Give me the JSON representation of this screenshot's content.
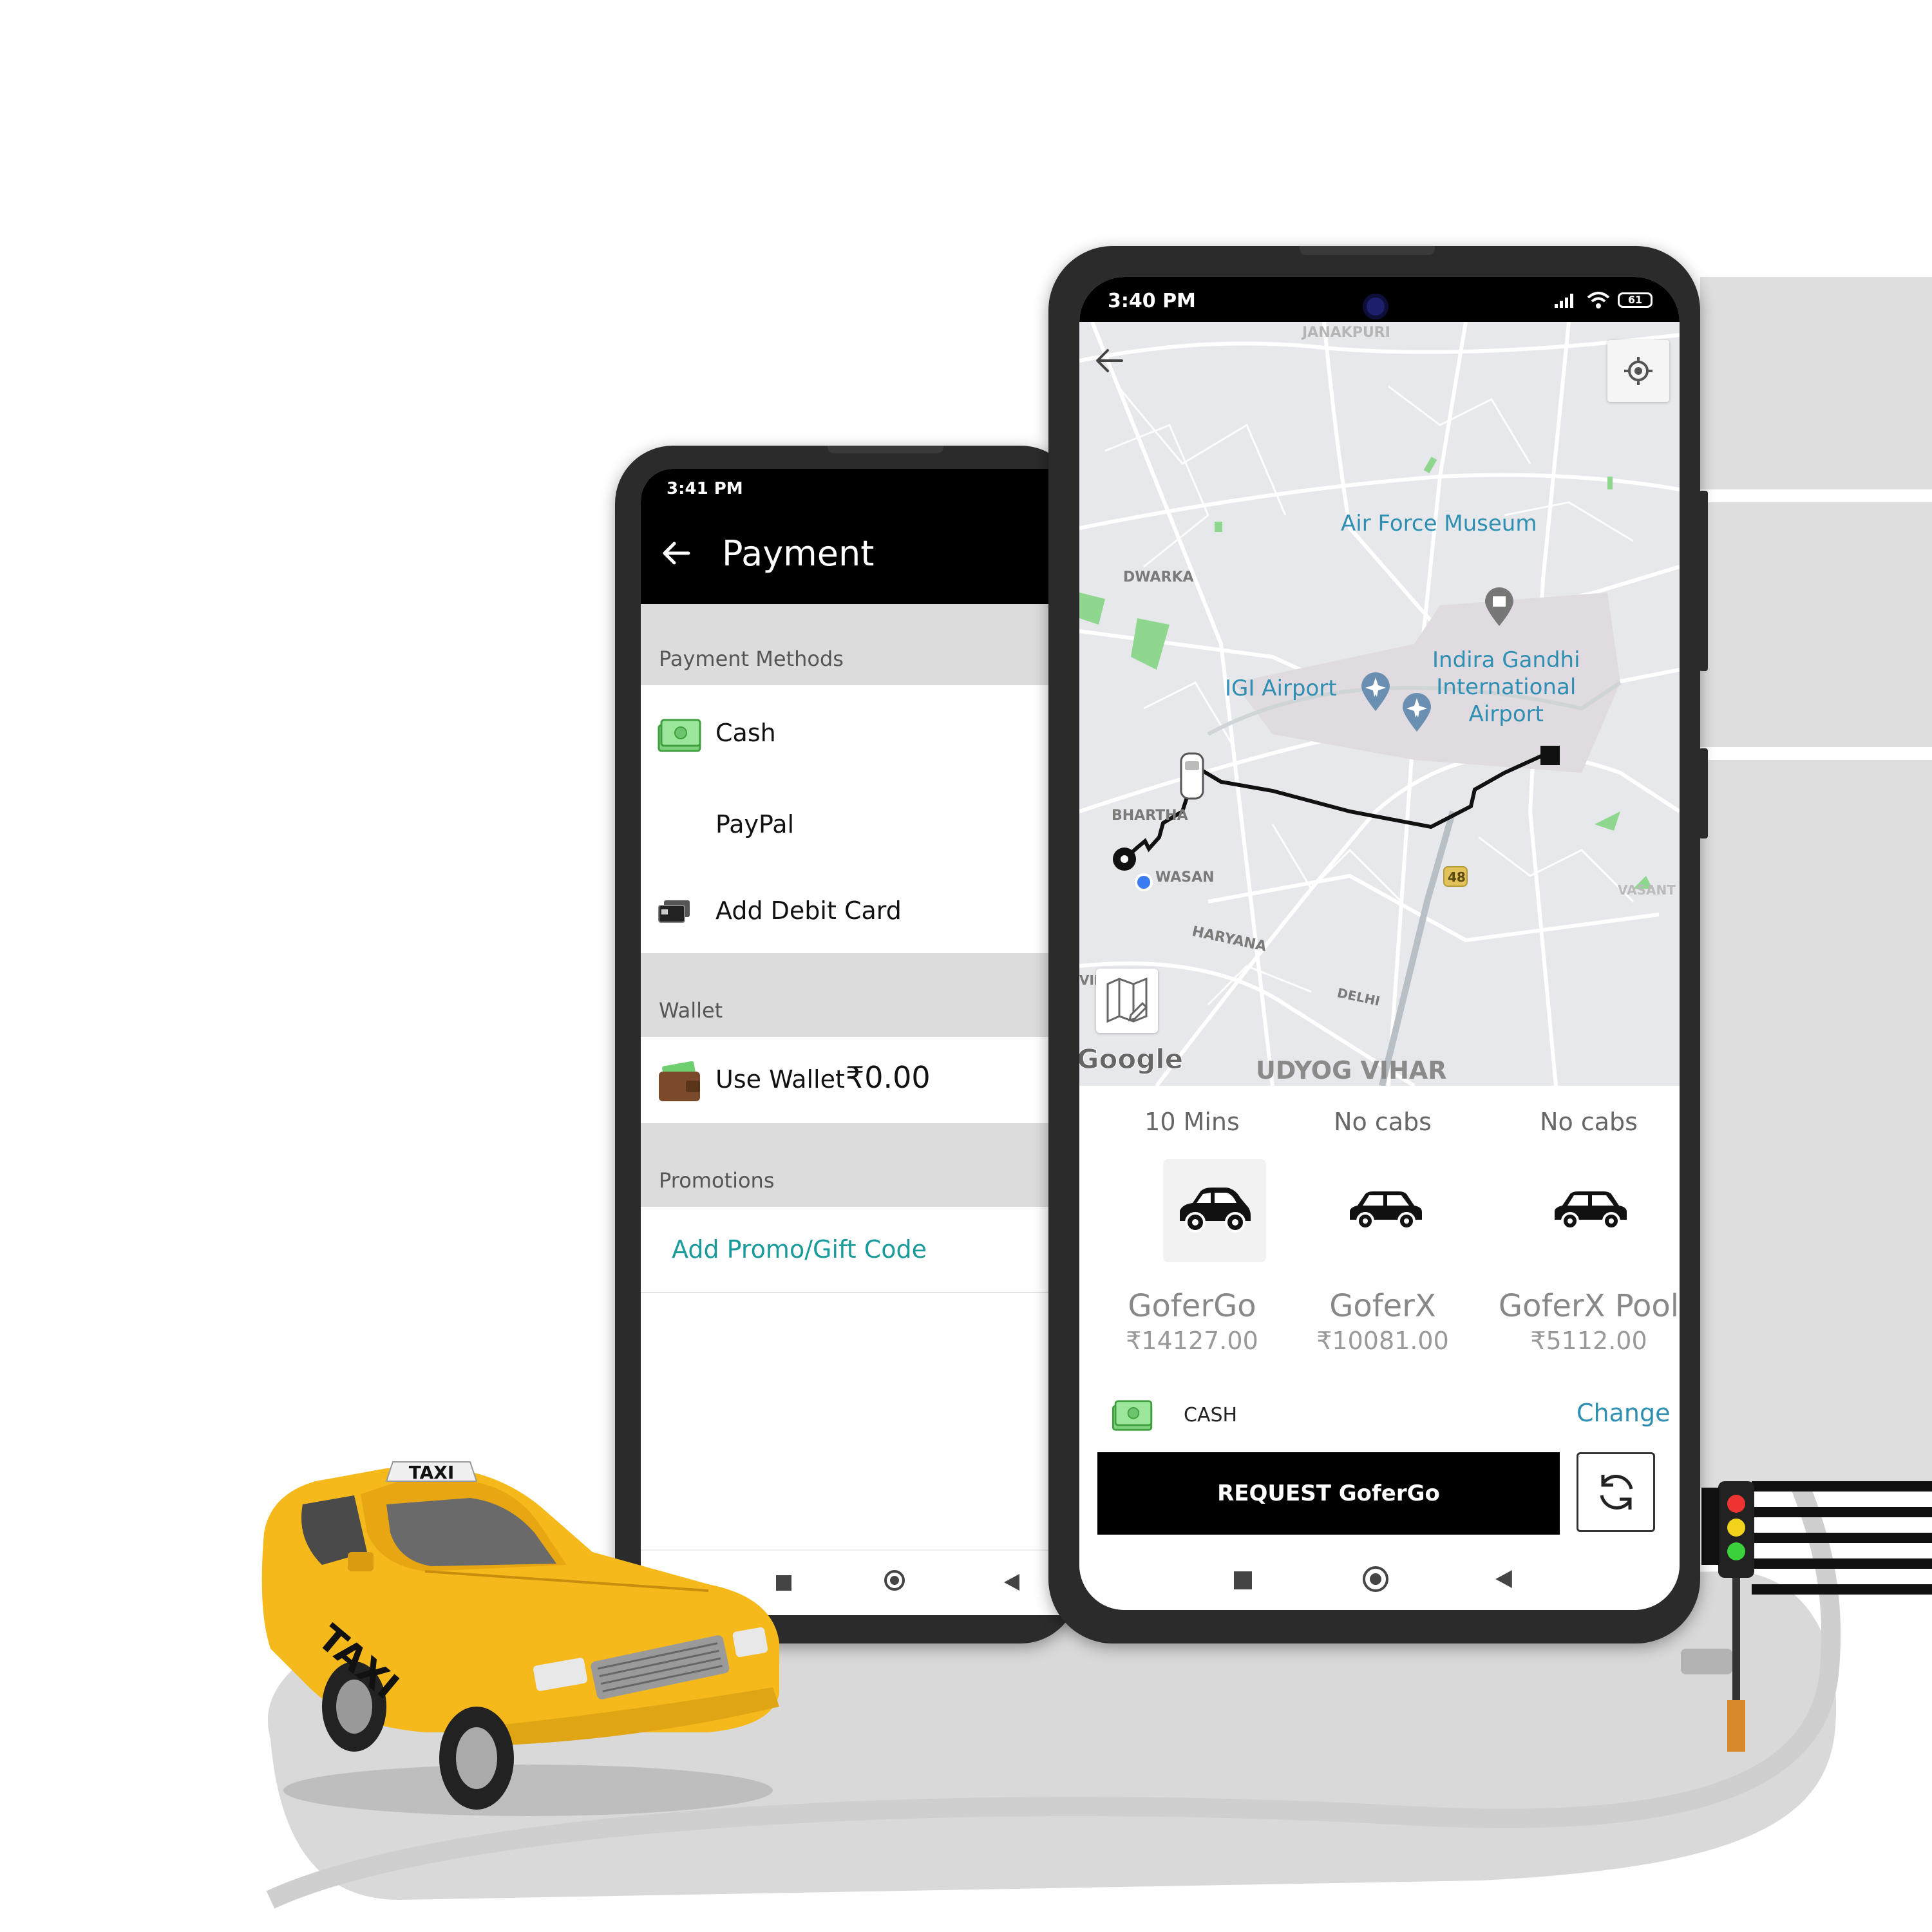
{
  "payment_screen": {
    "status_time": "3:41 PM",
    "title": "Payment",
    "sections": {
      "payment_methods": "Payment Methods",
      "wallet": "Wallet",
      "promotions": "Promotions"
    },
    "methods": {
      "cash": "Cash",
      "paypal": "PayPal",
      "debit": "Add Debit Card"
    },
    "wallet": {
      "label": "Use Wallet",
      "amount": "₹0.00"
    },
    "promo_link": "Add Promo/Gift Code"
  },
  "ride_screen": {
    "status_time": "3:40 PM",
    "battery": "61",
    "map": {
      "labels": {
        "janakpuri": "JANAKPURI",
        "dwarka": "DWARKA",
        "bharthal": "BHARTHA",
        "bijwasan": "WASAN",
        "haryana": "HARYANA",
        "delhi": "DELHI",
        "vasant": "VASANT",
        "vih": "VIH",
        "udyog_vihar": "UDYOG VIHAR",
        "highway": "48",
        "google": "Google"
      },
      "poi": {
        "air_force_museum": "Air Force Museum",
        "igi_airport": "IGI Airport",
        "indira_gandhi": "Indira Gandhi\nInternational\nAirport"
      }
    },
    "cabs": [
      {
        "eta": "10 Mins",
        "name": "GoferGo",
        "price": "₹14127.00"
      },
      {
        "eta": "No cabs",
        "name": "GoferX",
        "price": "₹10081.00"
      },
      {
        "eta": "No cabs",
        "name": "GoferX Pool",
        "price": "₹5112.00"
      }
    ],
    "payment_label": "CASH",
    "change_link": "Change",
    "request_button": "REQUEST GoferGo"
  },
  "taxi": {
    "roof_sign": "TAXI",
    "door_text": "TAXI"
  },
  "colors": {
    "accent_teal": "#2f8fb2",
    "promo_teal": "#1a9a9a",
    "taxi_yellow": "#f6b91c",
    "road_gray": "#d9d9d9"
  }
}
